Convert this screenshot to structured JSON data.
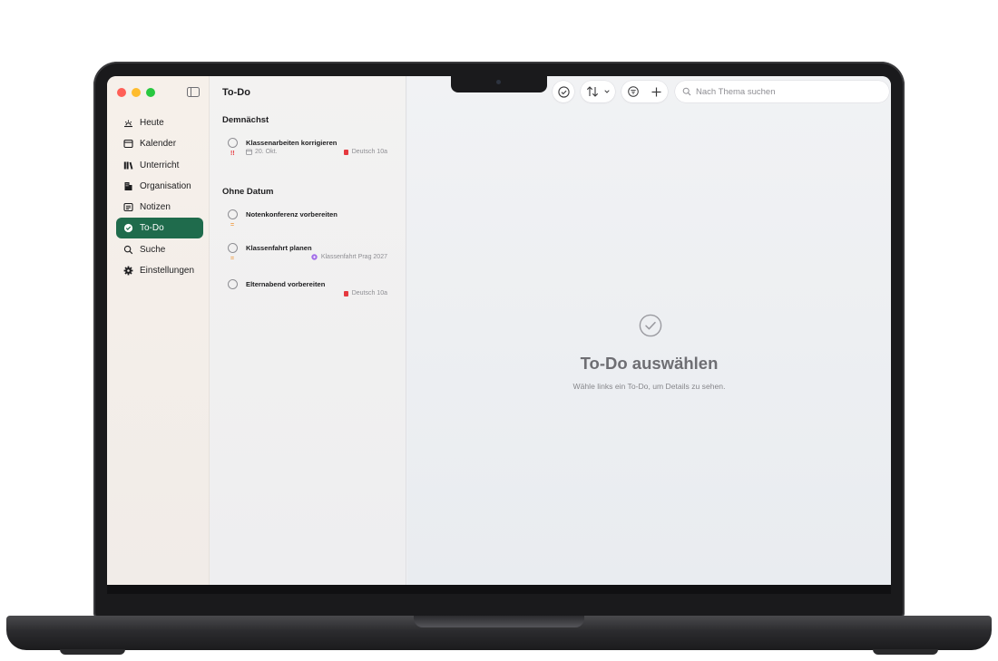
{
  "window": {
    "page_title": "To-Do"
  },
  "sidebar": {
    "items": [
      {
        "label": "Heute",
        "icon": "sunrise-icon",
        "active": false
      },
      {
        "label": "Kalender",
        "icon": "calendar-icon",
        "active": false
      },
      {
        "label": "Unterricht",
        "icon": "books-icon",
        "active": false
      },
      {
        "label": "Organisation",
        "icon": "building-icon",
        "active": false
      },
      {
        "label": "Notizen",
        "icon": "note-icon",
        "active": false
      },
      {
        "label": "To-Do",
        "icon": "checkmark-circle-icon",
        "active": true
      },
      {
        "label": "Suche",
        "icon": "search-icon",
        "active": false
      },
      {
        "label": "Einstellungen",
        "icon": "gear-icon",
        "active": false
      }
    ]
  },
  "sections": [
    {
      "title": "Demnächst",
      "todos": [
        {
          "title": "Klassenarbeiten korrigieren",
          "priority": "!!",
          "date": "20. Okt.",
          "tag": "Deutsch 10a",
          "tag_color": "#e5393f"
        }
      ]
    },
    {
      "title": "Ohne Datum",
      "todos": [
        {
          "title": "Notenkonferenz vorbereiten",
          "priority": "=",
          "date": "",
          "tag": "",
          "tag_color": ""
        },
        {
          "title": "Klassenfahrt planen",
          "priority": "=",
          "date": "",
          "tag": "Klassenfahrt Prag 2027",
          "tag_color": "#a36ee8"
        },
        {
          "title": "Elternabend vorbereiten",
          "priority": "",
          "date": "",
          "tag": "Deutsch 10a",
          "tag_color": "#e5393f"
        }
      ]
    }
  ],
  "search": {
    "placeholder": "Nach Thema suchen",
    "value": ""
  },
  "detail": {
    "empty_title": "To-Do auswählen",
    "empty_subtitle": "Wähle links ein To-Do, um Details zu sehen."
  },
  "colors": {
    "accent": "#1f6b4c",
    "priority_high": "#e5393f",
    "priority_low": "#f0a04b"
  }
}
